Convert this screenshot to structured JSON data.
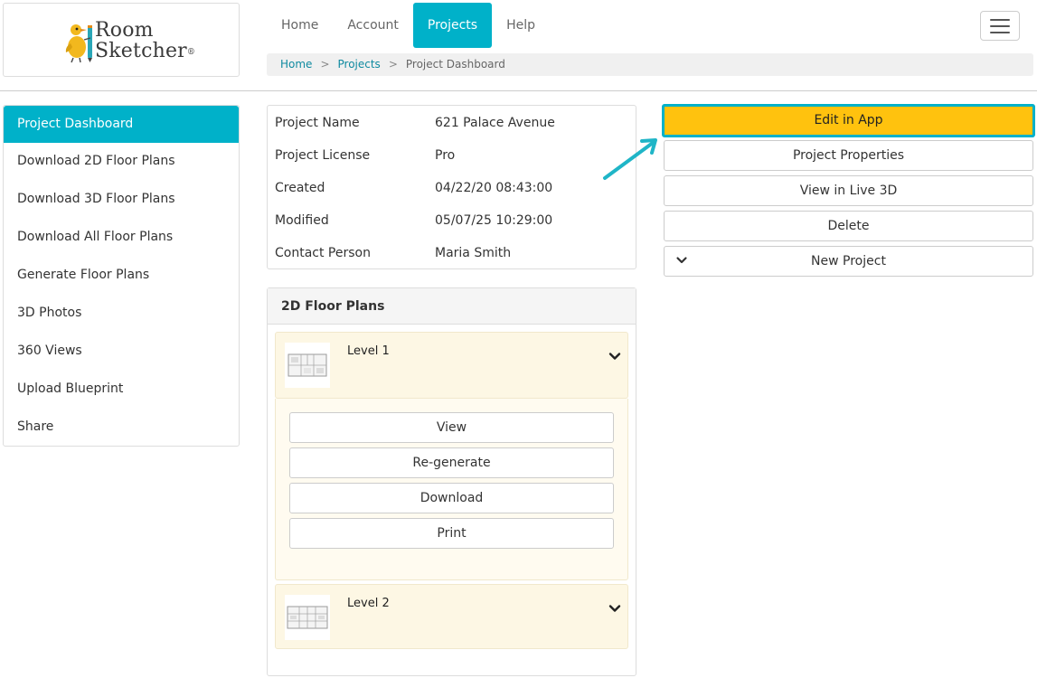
{
  "brand": {
    "line1": "Room",
    "line2": "Sketcher",
    "reg_mark": "®"
  },
  "nav": {
    "items": [
      {
        "label": "Home"
      },
      {
        "label": "Account"
      },
      {
        "label": "Projects"
      },
      {
        "label": "Help"
      }
    ],
    "active": "Projects",
    "menu_icon": "hamburger-icon"
  },
  "breadcrumb": {
    "items": [
      "Home",
      "Projects",
      "Project Dashboard"
    ],
    "separator": ">"
  },
  "sidebar": {
    "items": [
      {
        "label": "Project Dashboard"
      },
      {
        "label": "Download 2D Floor Plans"
      },
      {
        "label": "Download 3D Floor Plans"
      },
      {
        "label": "Download All Floor Plans"
      },
      {
        "label": "Generate Floor Plans"
      },
      {
        "label": "3D Photos"
      },
      {
        "label": "360 Views"
      },
      {
        "label": "Upload Blueprint"
      },
      {
        "label": "Share"
      }
    ],
    "active": "Project Dashboard"
  },
  "project_info": {
    "rows": [
      {
        "key": "Project Name",
        "value": "621 Palace Avenue"
      },
      {
        "key": "Project License",
        "value": "Pro"
      },
      {
        "key": "Created",
        "value": "04/22/20 08:43:00"
      },
      {
        "key": "Modified",
        "value": "05/07/25 10:29:00"
      },
      {
        "key": "Contact Person",
        "value": "Maria Smith"
      }
    ]
  },
  "floor_plans": {
    "title": "2D Floor Plans",
    "levels": [
      {
        "name": "Level 1",
        "expanded": true
      },
      {
        "name": "Level 2",
        "expanded": false
      }
    ],
    "actions": [
      {
        "label": "View"
      },
      {
        "label": "Re-generate"
      },
      {
        "label": "Download"
      },
      {
        "label": "Print"
      }
    ]
  },
  "actions": {
    "edit_in_app": "Edit in App",
    "project_properties": "Project Properties",
    "view_live_3d": "View in Live 3D",
    "delete": "Delete",
    "new_project": "New Project"
  },
  "colors": {
    "accent": "#00b1c9",
    "primary_button": "#ffc20e",
    "level_background": "#fdf7e4",
    "link": "#0f8aa0"
  }
}
